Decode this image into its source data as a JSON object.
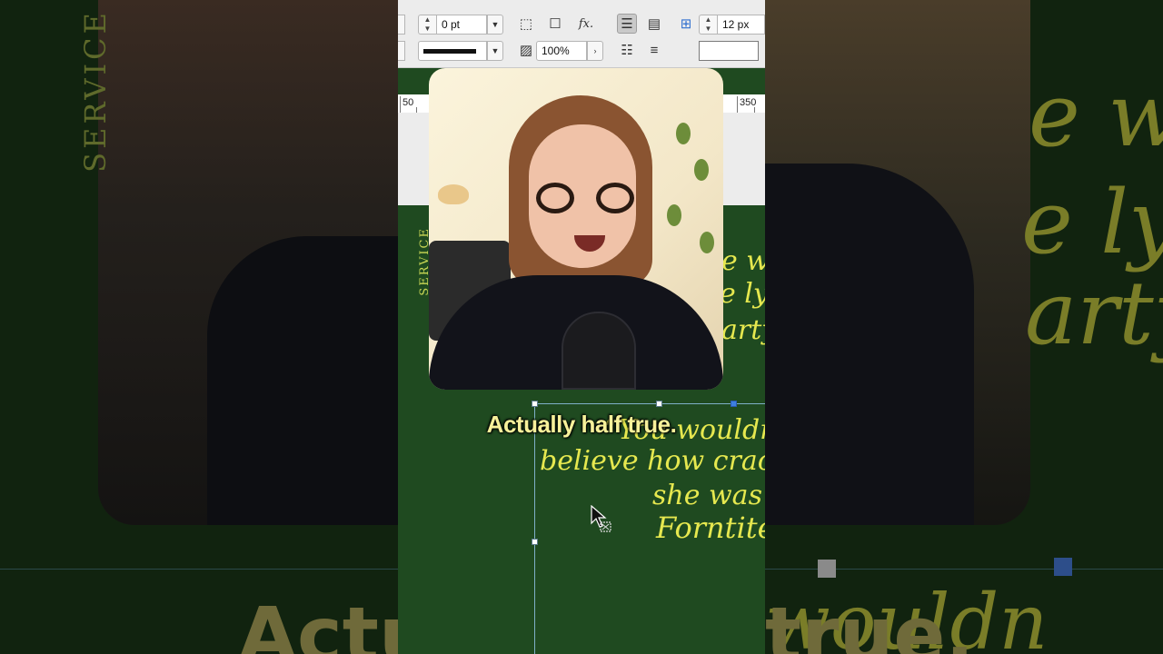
{
  "toolbar": {
    "stroke_weight": "0 pt",
    "zoom_percent": "100%",
    "size_px": "12 px",
    "fx_label": "fx."
  },
  "ruler": {
    "left_label": "50",
    "right_label": "350"
  },
  "artwork": {
    "vertical_label": "SERVICE",
    "script_right_1": "e wo",
    "script_right_2": "e ly",
    "script_right_3": "arty",
    "quote_line_1": "“You wouldn",
    "quote_line_2": "believe how cracke",
    "quote_line_3": "she was a",
    "quote_line_4": "Forntite"
  },
  "caption": "Actually half true.",
  "background": {
    "vertical_label": "SERVICE",
    "script_1": "e wo",
    "script_2": "e ly",
    "script_3": "arty",
    "script_4": "wouldn",
    "caption_left": "Actu",
    "caption_right": "true."
  },
  "colors": {
    "canvas_green": "#1f4a20",
    "script_yellow": "#e6e84f",
    "caption_yellow": "#f7f19a",
    "selection_blue": "#3d7fe0"
  }
}
